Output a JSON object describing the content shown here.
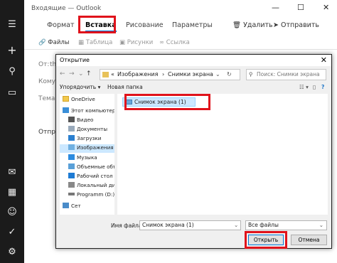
{
  "window": {
    "title": "Входящие — Outlook",
    "min": "—",
    "max": "☐",
    "close": "✕"
  },
  "leftnav": {
    "icons": [
      "hamburger-icon",
      "compose-icon",
      "user-icon",
      "folder-icon",
      "mail-icon",
      "calendar-icon",
      "people-icon",
      "todo-icon",
      "settings-icon"
    ]
  },
  "ribbon": {
    "tabs": [
      "Формат",
      "Вставка",
      "Рисование",
      "Параметры"
    ],
    "delete": "Удалить",
    "send": "Отправить",
    "commands": [
      "Файлы",
      "Таблица",
      "Рисунки",
      "Ссылка"
    ]
  },
  "compose": {
    "from_label": "От:",
    "from_value": "thi",
    "to_label": "Кому:",
    "subject_label": "Тема",
    "send_label": "Отправ"
  },
  "dialog": {
    "title": "Открытие",
    "path": [
      "Изображения",
      "Снимки экрана"
    ],
    "search_placeholder": "Поиск: Снимки экрана",
    "organize": "Упорядочить ▾",
    "new_folder": "Новая папка",
    "nav": [
      {
        "label": "OneDrive",
        "icon": "onedrive-icon"
      },
      {
        "label": "Этот компьютер",
        "icon": "computer-icon"
      },
      {
        "label": "Видео",
        "icon": "video-icon"
      },
      {
        "label": "Документы",
        "icon": "documents-icon"
      },
      {
        "label": "Загрузки",
        "icon": "downloads-icon"
      },
      {
        "label": "Изображения",
        "icon": "pictures-icon",
        "selected": true
      },
      {
        "label": "Музыка",
        "icon": "music-icon"
      },
      {
        "label": "Объемные объ",
        "icon": "3d-objects-icon"
      },
      {
        "label": "Рабочий стол",
        "icon": "desktop-icon"
      },
      {
        "label": "Локальный дис",
        "icon": "drive-icon"
      },
      {
        "label": "Programm (D:)",
        "icon": "drive-icon"
      },
      {
        "label": "Сет",
        "icon": "network-icon"
      }
    ],
    "file": "Снимок экрана (1)",
    "filename_label": "Имя файла:",
    "filename_value": "Снимок экрана (1)",
    "filetype_value": "Все файлы",
    "open": "Открыть",
    "cancel": "Отмена"
  }
}
